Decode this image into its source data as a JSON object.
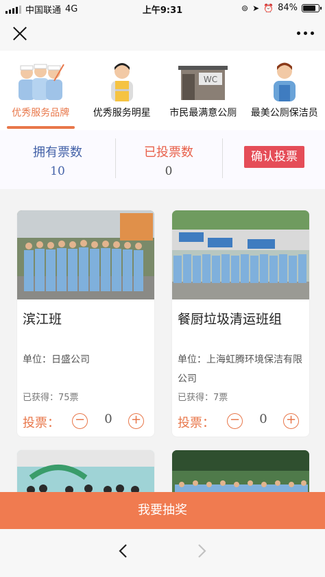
{
  "status_bar": {
    "carrier": "中国联通",
    "network": "4G",
    "time": "上午9:31",
    "battery": "84%"
  },
  "tabs": [
    {
      "label": "优秀服务品牌",
      "active": true
    },
    {
      "label": "优秀服务明星",
      "active": false
    },
    {
      "label": "市民最满意公厕",
      "active": false
    },
    {
      "label": "最美公厕保洁员",
      "active": false
    }
  ],
  "votes": {
    "owned_label": "拥有票数",
    "owned_value": "10",
    "voted_label": "已投票数",
    "voted_value": "0",
    "confirm_label": "确认投票"
  },
  "cards": [
    {
      "name": "滨江班",
      "unit": "单位：日盛公司",
      "votes_got": "已获得：75票",
      "vote_label": "投票：",
      "minus": "−",
      "plus": "+",
      "count": "0"
    },
    {
      "name": "餐厨垃圾清运班组",
      "unit": "单位：上海虹腾环境保洁有限公司",
      "votes_got": "已获得：7票",
      "vote_label": "投票：",
      "minus": "−",
      "plus": "+",
      "count": "0"
    }
  ],
  "lottery_label": "我要抽奖",
  "photo_sign": "WC",
  "colors": {
    "accent": "#e8774a",
    "confirm": "#e54d58",
    "owned": "#4462a8",
    "lottery": "#f07b50"
  }
}
